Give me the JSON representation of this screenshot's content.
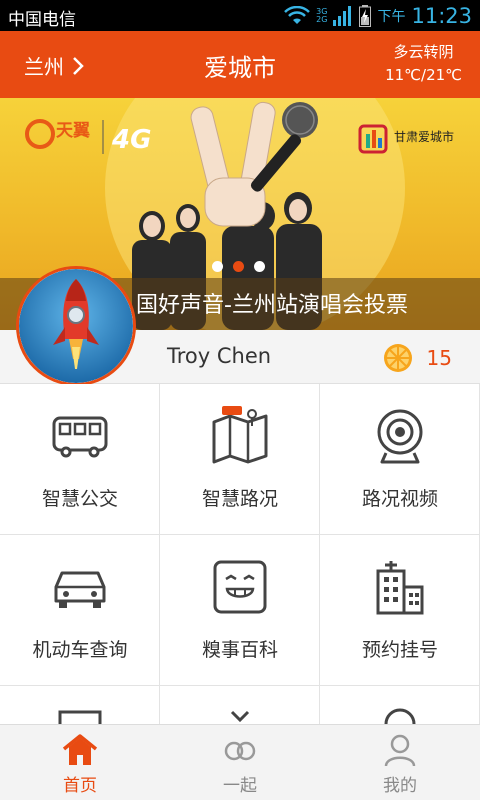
{
  "status_bar": {
    "carrier": "中国电信",
    "network_top": "3G",
    "network_bottom": "2G",
    "ampm": "下午",
    "time": "11:23"
  },
  "header": {
    "city": "兰州",
    "title": "爱城市",
    "weather_condition": "多云转阴",
    "weather_temp": "11℃/21℃"
  },
  "banner": {
    "caption": "国好声音-兰州站演唱会投票",
    "logo_brand": "天翼",
    "logo_4g": "4G",
    "logo_right": "甘肃爱城市",
    "slide_count": 3,
    "active_slide": 2
  },
  "user": {
    "name": "Troy Chen",
    "points": "15"
  },
  "grid": [
    {
      "label": "智慧公交",
      "icon": "bus-icon"
    },
    {
      "label": "智慧路况",
      "icon": "road-map-icon"
    },
    {
      "label": "路况视频",
      "icon": "camera-icon"
    },
    {
      "label": "机动车查询",
      "icon": "car-icon"
    },
    {
      "label": "糗事百科",
      "icon": "smiley-icon"
    },
    {
      "label": "预约挂号",
      "icon": "hospital-icon"
    }
  ],
  "tabs": [
    {
      "label": "首页",
      "icon": "home-icon",
      "active": true
    },
    {
      "label": "一起",
      "icon": "rings-icon",
      "active": false
    },
    {
      "label": "我的",
      "icon": "user-icon",
      "active": false
    }
  ],
  "colors": {
    "accent": "#e84b12",
    "status_blue": "#38b4e4"
  }
}
